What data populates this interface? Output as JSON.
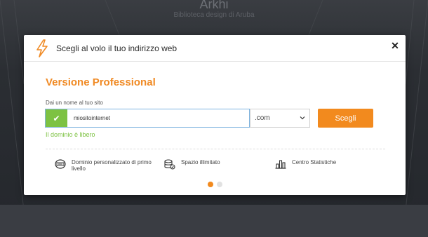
{
  "background": {
    "title": "Arkhi",
    "subtitle": "Biblioteca design di Aruba"
  },
  "modal": {
    "title": "Scegli al volo il tuo indirizzo web",
    "version_heading": "Versione Professional",
    "field_label": "Dai un nome al tuo sito",
    "domain_value": "miositointernet",
    "tld_selected": ".com",
    "submit_label": "Scegli",
    "status_text": "Il dominio è libero",
    "features": [
      {
        "icon": "server-icon",
        "label": "Dominio personalizzato di primo livello"
      },
      {
        "icon": "database-icon",
        "label": "Spazio illimitato"
      },
      {
        "icon": "bar-chart-icon",
        "label": "Centro Statistiche"
      }
    ],
    "carousel": {
      "total": 2,
      "active": 1
    }
  },
  "colors": {
    "accent": "#f28a1e",
    "success": "#7dc242",
    "heading": "#f08a24"
  }
}
